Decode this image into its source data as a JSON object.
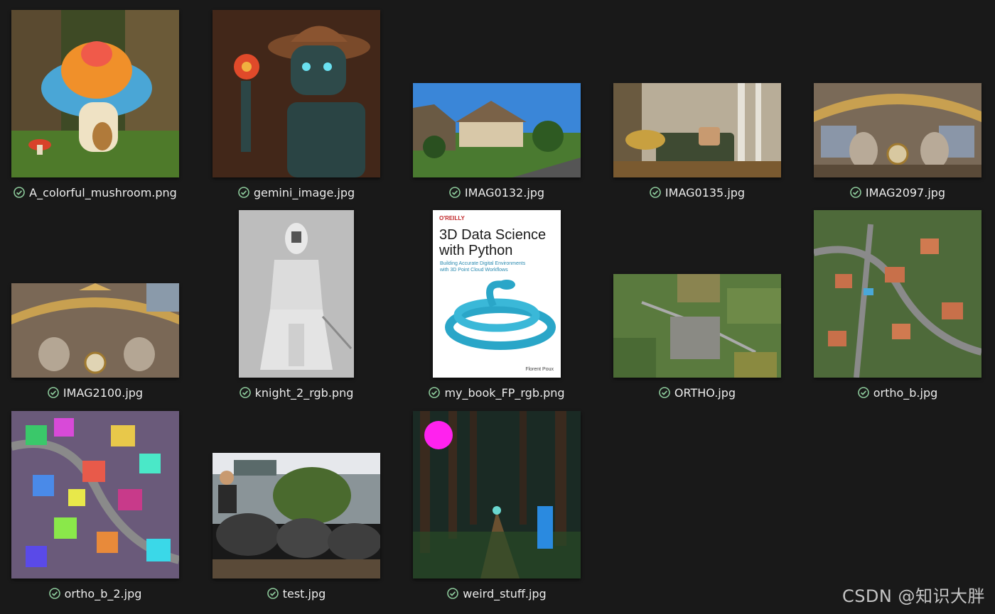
{
  "status_icon": "synced-check-icon",
  "colors": {
    "background": "#191919",
    "check": "#8cc99a",
    "text": "#ececec"
  },
  "files": [
    {
      "name": "A_colorful_mushroom.png",
      "icon": "mushroom-image"
    },
    {
      "name": "gemini_image.jpg",
      "icon": "robot-cowboy-image"
    },
    {
      "name": "IMAG0132.jpg",
      "icon": "house-landscape-image"
    },
    {
      "name": "IMAG0135.jpg",
      "icon": "living-room-image"
    },
    {
      "name": "IMAG2097.jpg",
      "icon": "ornate-ceiling-image"
    },
    {
      "name": "IMAG2100.jpg",
      "icon": "ornate-clock-image"
    },
    {
      "name": "knight_2_rgb.png",
      "icon": "knight-statue-image"
    },
    {
      "name": "my_book_FP_rgb.png",
      "icon": "book-cover-image"
    },
    {
      "name": "ORTHO.jpg",
      "icon": "aerial-village-image"
    },
    {
      "name": "ortho_b.jpg",
      "icon": "aerial-houses-image"
    },
    {
      "name": "ortho_b_2.jpg",
      "icon": "segmentation-map-image"
    },
    {
      "name": "test.jpg",
      "icon": "river-rocks-image"
    },
    {
      "name": "weird_stuff.jpg",
      "icon": "forest-path-image"
    }
  ],
  "book": {
    "publisher": "O'REILLY",
    "title_line1": "3D Data Science",
    "title_line2": "with Python",
    "subtitle_line1": "Building Accurate Digital Environments",
    "subtitle_line2": "with 3D Point Cloud Workflows",
    "author": "Florent Poux"
  },
  "watermark": "CSDN @知识大胖"
}
